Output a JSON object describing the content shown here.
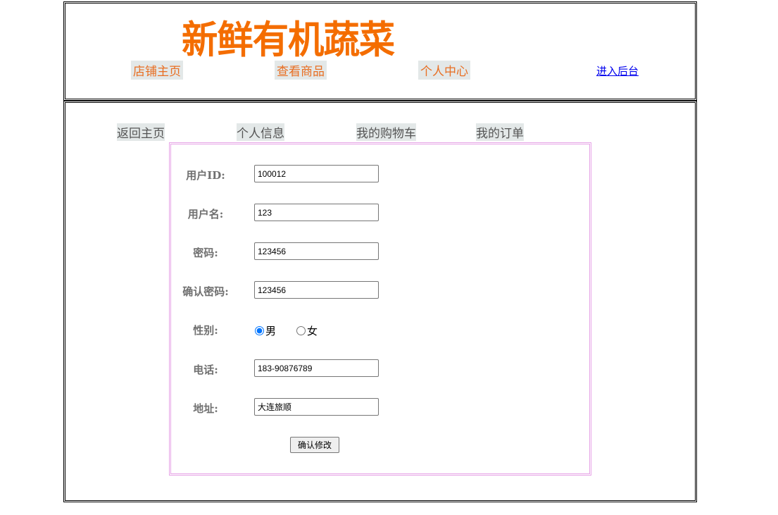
{
  "header": {
    "logo": "新鲜有机蔬菜",
    "nav": [
      "店铺主页",
      "查看商品",
      "个人中心"
    ],
    "admin_link": "进入后台"
  },
  "subnav": [
    "返回主页",
    "个人信息",
    "我的购物车",
    "我的订单"
  ],
  "form": {
    "user_id_label": "用户ID:",
    "user_id": "100012",
    "username_label": "用户名:",
    "username": "123",
    "password_label": "密码:",
    "password": "123456",
    "confirm_label": "确认密码:",
    "confirm": "123456",
    "gender_label": "性别:",
    "gender_options": [
      "男",
      "女"
    ],
    "gender_selected": "男",
    "phone_label": "电话:",
    "phone": "183-90876789",
    "address_label": "地址:",
    "address": "大连旅顺",
    "submit": "确认修改"
  }
}
